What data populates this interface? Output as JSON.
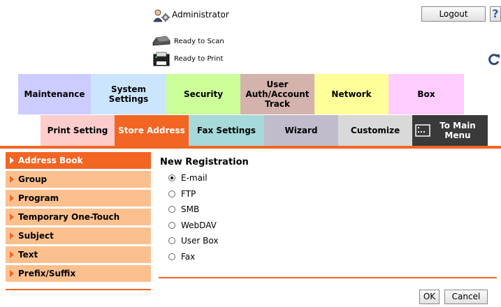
{
  "header": {
    "user_label": "Administrator",
    "logout_label": "Logout",
    "help_label": "?",
    "scan_status": "Ready to Scan",
    "print_status": "Ready to Print"
  },
  "top_tabs": [
    {
      "label": "Maintenance",
      "color": "#ccccff"
    },
    {
      "label": "System Settings",
      "color": "#cce5ff"
    },
    {
      "label": "Security",
      "color": "#ccff99"
    },
    {
      "label": "User Auth/Account Track",
      "color": "#d4b3ad"
    },
    {
      "label": "Network",
      "color": "#ffff99"
    },
    {
      "label": "Box",
      "color": "#ffccff"
    }
  ],
  "sub_tabs": [
    {
      "label": "Print Setting",
      "color": "#ffcccc"
    },
    {
      "label": "Store Address",
      "color": "#f26522"
    },
    {
      "label": "Fax Settings",
      "color": "#a6d9d9"
    },
    {
      "label": "Wizard",
      "color": "#c0bccc"
    },
    {
      "label": "Customize",
      "color": "#d9d9d9"
    },
    {
      "label": "To Main Menu",
      "color": "#3a3a3a"
    }
  ],
  "sidebar": {
    "items": [
      {
        "label": "Address Book",
        "active": true
      },
      {
        "label": "Group"
      },
      {
        "label": "Program"
      },
      {
        "label": "Temporary One-Touch"
      },
      {
        "label": "Subject"
      },
      {
        "label": "Text"
      },
      {
        "label": "Prefix/Suffix"
      }
    ]
  },
  "main": {
    "title": "New Registration",
    "options": [
      {
        "label": "E-mail",
        "selected": true
      },
      {
        "label": "FTP"
      },
      {
        "label": "SMB"
      },
      {
        "label": "WebDAV"
      },
      {
        "label": "User Box"
      },
      {
        "label": "Fax"
      }
    ],
    "ok_label": "OK",
    "cancel_label": "Cancel"
  }
}
